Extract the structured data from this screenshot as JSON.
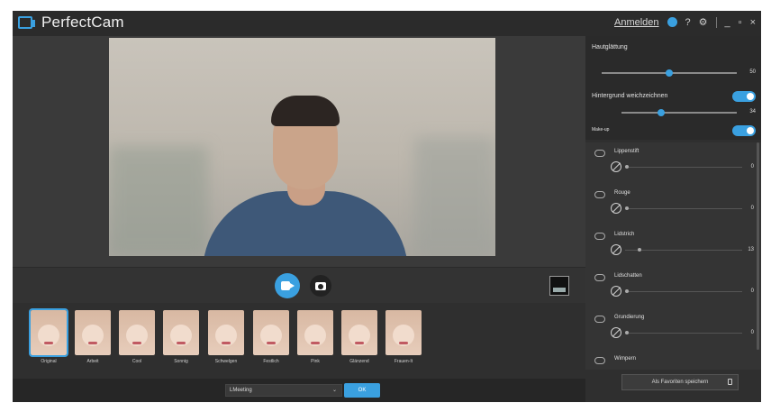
{
  "app": {
    "title": "PerfectCam"
  },
  "titlebar": {
    "login_label": "Anmelden",
    "help_label": "?",
    "settings_label": "⚙",
    "minimize_label": "_",
    "maximize_label": "▫",
    "close_label": "×"
  },
  "panel": {
    "skin_smoothing": {
      "label": "Hautglättung",
      "value": "50",
      "level": 0.5
    },
    "background_blur": {
      "label": "Hintergrund weichzeichnen",
      "value": "34",
      "level": 0.34,
      "enabled": true
    },
    "makeup": {
      "label": "Make-up",
      "enabled": true
    },
    "features": [
      {
        "name": "Lippenstift",
        "value": "0"
      },
      {
        "name": "Rouge",
        "value": "0"
      },
      {
        "name": "Lidstrich",
        "value": "13"
      },
      {
        "name": "Lidschatten",
        "value": "0"
      },
      {
        "name": "Grundierung",
        "value": "0"
      },
      {
        "name": "Wimpern",
        "value": ""
      }
    ],
    "save_button": "Als Favoriten speichern"
  },
  "filters": [
    {
      "label": "Original",
      "selected": true
    },
    {
      "label": "Arbeit"
    },
    {
      "label": "Cool"
    },
    {
      "label": "Sonnig"
    },
    {
      "label": "Schwelgen"
    },
    {
      "label": "Festlich"
    },
    {
      "label": "Pink"
    },
    {
      "label": "Glänzend"
    },
    {
      "label": "Frauen-It"
    }
  ],
  "bottom": {
    "dropdown_value": "LMeeting",
    "dropdown_arrow": "⌄",
    "ok_label": "OK"
  },
  "colors": {
    "accent": "#3aa0e0",
    "panel_bg": "#2f2f2f",
    "titlebar_bg": "#2b2b2b"
  }
}
